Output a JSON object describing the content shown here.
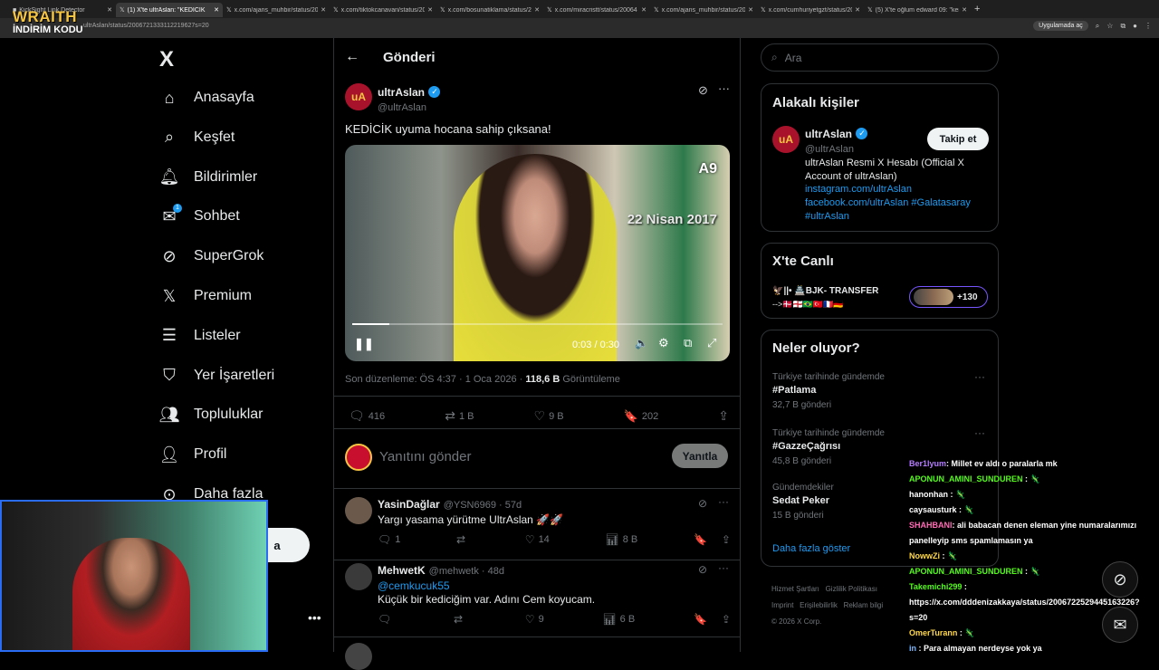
{
  "browser": {
    "tabs": [
      {
        "label": "KickSight Link Detector",
        "active": false
      },
      {
        "label": "(1) X'te ultrAslan: \"KEDİCİK",
        "active": true
      },
      {
        "label": "x.com/ajans_muhbir/status/200",
        "active": false
      },
      {
        "label": "x.com/tiktokcanavari/status/20",
        "active": false
      },
      {
        "label": "x.com/bosunatiklama/status/20",
        "active": false
      },
      {
        "label": "x.com/miracristt/status/20064",
        "active": false
      },
      {
        "label": "x.com/ajans_muhbir/status/200",
        "active": false
      },
      {
        "label": "x.com/cumhuriyetgzt/status/20",
        "active": false
      },
      {
        "label": "(5) X'te oğlum edward 09: \"ken",
        "active": false
      }
    ],
    "url": "ultrAslan/status/2006721333112219627s=20",
    "app_chip": "Uygulamada aç"
  },
  "overlay": {
    "brand": "WRAITH",
    "promo": "İNDİRİM KODU"
  },
  "nav": {
    "logo": "X",
    "items": [
      {
        "label": "Anasayfa",
        "icon": "home-icon"
      },
      {
        "label": "Keşfet",
        "icon": "search-icon"
      },
      {
        "label": "Bildirimler",
        "icon": "bell-icon"
      },
      {
        "label": "Sohbet",
        "icon": "mail-icon",
        "badge": "1"
      },
      {
        "label": "SuperGrok",
        "icon": "grok-icon"
      },
      {
        "label": "Premium",
        "icon": "x-premium-icon"
      },
      {
        "label": "Listeler",
        "icon": "list-icon"
      },
      {
        "label": "Yer İşaretleri",
        "icon": "bookmark-icon"
      },
      {
        "label": "Topluluklar",
        "icon": "communities-icon"
      },
      {
        "label": "Profil",
        "icon": "profile-icon"
      },
      {
        "label": "Daha fazla",
        "icon": "more-circle-icon"
      }
    ],
    "post_button": "a"
  },
  "post": {
    "header": "Gönderi",
    "author": {
      "name": "ultrAslan",
      "handle": "@ultrAslan",
      "avatar_text": "uA"
    },
    "text": "KEDİCİK uyuma hocana sahip çıksana!",
    "video": {
      "watermark": "A9",
      "caption": "22 Nisan 2017",
      "time": "0:03 / 0:30",
      "progress": 0.1
    },
    "meta": {
      "edited": "Son düzenleme: ÖS 4:37 · 1 Oca 2026 ·",
      "views": "118,6 B",
      "views_label": "Görüntüleme"
    },
    "stats": {
      "replies": "416",
      "reposts": "1 B",
      "likes": "9 B",
      "bookmarks": "202"
    },
    "reply_placeholder": "Yanıtını gönder",
    "reply_button": "Yanıtla"
  },
  "replies": [
    {
      "name": "YasinDağlar",
      "handle": "@YSN6969 · 57d",
      "text": "Yargı yasama yürütme UltrAslan 🚀🚀",
      "mention": "",
      "stats": {
        "replies": "1",
        "reposts": "",
        "likes": "14",
        "views": "8 B"
      }
    },
    {
      "name": "MehwetK",
      "handle": "@mehwetk · 48d",
      "mention": "@cemkucuk55",
      "text": "Küçük bir kediciğim var. Adını Cem koyucam.",
      "stats": {
        "replies": "",
        "reposts": "",
        "likes": "9",
        "views": "6 B"
      }
    }
  ],
  "right": {
    "search_placeholder": "Ara",
    "related": {
      "title": "Alakalı kişiler",
      "name": "ultrAslan",
      "handle": "@ultrAslan",
      "follow": "Takip et",
      "bio": "ultrAslan Resmi X Hesabı (Official X Account of ultrAslan)",
      "links": [
        "instagram.com/ultrAslan",
        "facebook.com/ultrAslan #Galatasaray",
        "#ultrAslan"
      ]
    },
    "live": {
      "title": "X'te Canlı",
      "item": "🦅||• 🏯BJK- TRANSFER",
      "item2": "-->🇩🇰🏴󠁧󠁢󠁥󠁮󠁧󠁿🇧🇷🇹🇷🇫🇷🇩🇪",
      "count": "+130"
    },
    "trends": {
      "title": "Neler oluyor?",
      "items": [
        {
          "context": "Türkiye tarihinde gündemde",
          "name": "#Patlama",
          "count": "32,7 B gönderi"
        },
        {
          "context": "Türkiye tarihinde gündemde",
          "name": "#GazzeÇağrısı",
          "count": "45,8 B gönderi"
        },
        {
          "context": "Gündemdekiler",
          "name": "Sedat Peker",
          "count": "15 B gönderi"
        }
      ],
      "more": "Daha fazla göster"
    },
    "footer": {
      "links": [
        "Hizmet Şartları",
        "Gizlilik Politikası",
        "Imprint",
        "Erişilebilirlik",
        "Reklam bilgi"
      ],
      "copy": "© 2026 X Corp."
    }
  },
  "chat": [
    {
      "user": "Ber1lyum",
      "color": "#b57cff",
      "msg": ": Millet ev aldı o paralarla mk"
    },
    {
      "user": "APONUN_AMINI_SUNDUREN",
      "color": "#53fc18",
      "msg": " : 🦎"
    },
    {
      "user": "hanonhan",
      "color": "#ffffff",
      "msg": " : 🦎"
    },
    {
      "user": "caysausturk",
      "color": "#ffffff",
      "msg": " : 🦎"
    },
    {
      "user": "SHAHBANI",
      "color": "#ff6bb5",
      "msg": ": ali babacan denen eleman yine numaralarımızı"
    },
    {
      "user": "",
      "color": "#ffffff",
      "msg": "panelleyip sms spamlamasın ya"
    },
    {
      "user": "NowwZi",
      "color": "#ffd84a",
      "msg": " : 🦎"
    },
    {
      "user": "APONUN_AMINI_SUNDUREN",
      "color": "#53fc18",
      "msg": " : 🦎"
    },
    {
      "user": "Takemichi299",
      "color": "#53fc18",
      "msg": " :"
    },
    {
      "user": "",
      "color": "#ffffff",
      "msg": "https://x.com/dddenizakkaya/status/2006722529445163226?"
    },
    {
      "user": "",
      "color": "#ffffff",
      "msg": "s=20"
    },
    {
      "user": "OmerTurann",
      "color": "#ffd84a",
      "msg": " : 🦎"
    },
    {
      "user": "in",
      "color": "#7ab8ff",
      "msg": " : Para almayan nerdeyse yok ya"
    }
  ]
}
